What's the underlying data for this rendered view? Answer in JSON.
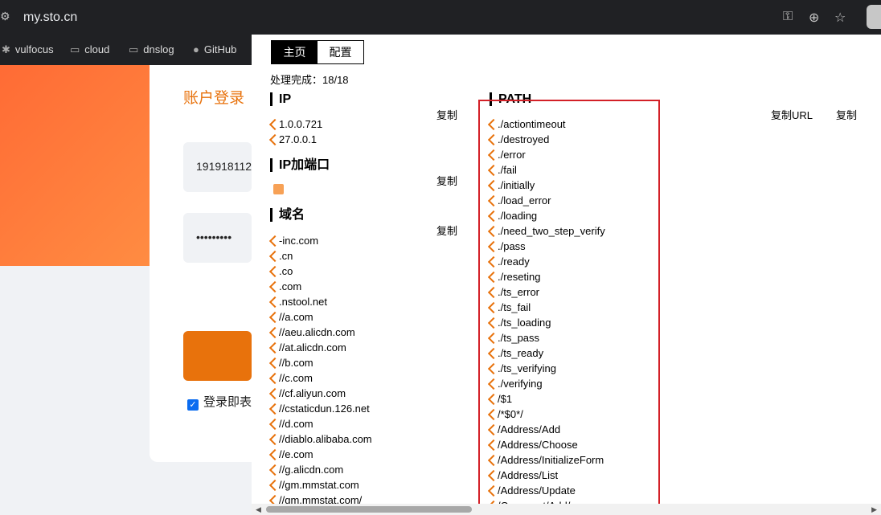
{
  "browser": {
    "url": "my.sto.cn",
    "bookmarks": [
      {
        "label": "vulfocus",
        "icon": "vulfocus-icon"
      },
      {
        "label": "cloud",
        "icon": "folder-icon"
      },
      {
        "label": "dnslog",
        "icon": "folder-icon"
      },
      {
        "label": "GitHub",
        "icon": "github-icon"
      }
    ]
  },
  "login": {
    "title": "账户登录",
    "username": "191918112",
    "password": "•••••••••",
    "agree": "登录即表"
  },
  "panel": {
    "tabs": [
      {
        "label": "主页"
      },
      {
        "label": "配置"
      }
    ],
    "progress": "处理完成：18/18",
    "ip": {
      "title": "IP",
      "copy": "复制",
      "items": [
        "1.0.0.721",
        "27.0.0.1"
      ]
    },
    "ipport": {
      "title": "IP加端口",
      "copy": "复制"
    },
    "domain": {
      "title": "域名",
      "copy": "复制",
      "items": [
        "-inc.com",
        ".cn",
        ".co",
        ".com",
        ".nstool.net",
        "//a.com",
        "//aeu.alicdn.com",
        "//at.alicdn.com",
        "//b.com",
        "//c.com",
        "//cf.aliyun.com",
        "//cstaticdun.126.net",
        "//d.com",
        "//diablo.alibaba.com",
        "//e.com",
        "//g.alicdn.com",
        "//gm.mmstat.com",
        "//gm.mmstat.com/"
      ]
    },
    "path": {
      "title": "PATH",
      "copy_url": "复制URL",
      "copy": "复制",
      "items": [
        "./actiontimeout",
        "./destroyed",
        "./error",
        "./fail",
        "./initially",
        "./load_error",
        "./loading",
        "./need_two_step_verify",
        "./pass",
        "./ready",
        "./reseting",
        "./ts_error",
        "./ts_fail",
        "./ts_loading",
        "./ts_pass",
        "./ts_ready",
        "./ts_verifying",
        "./verifying",
        "/$1",
        "/*$0*/",
        "/Address/Add",
        "/Address/Choose",
        "/Address/InitializeForm",
        "/Address/List",
        "/Address/Update",
        "/Comment/Add/"
      ]
    }
  }
}
